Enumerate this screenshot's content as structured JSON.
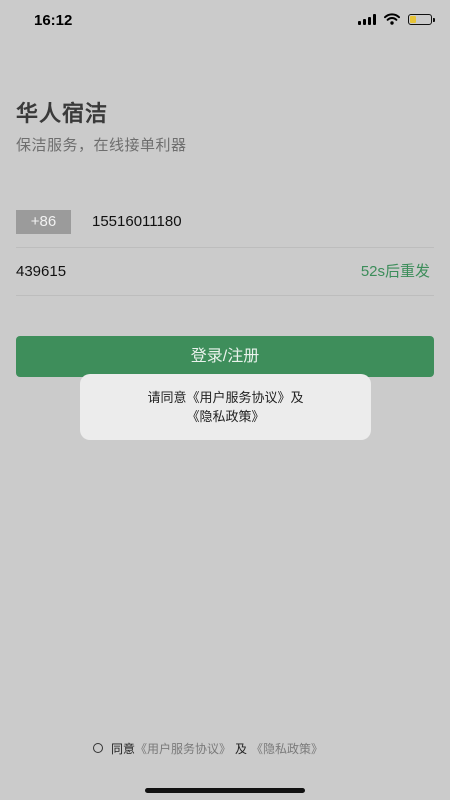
{
  "status_bar": {
    "time": "16:12",
    "battery_level": 0.3,
    "battery_color": "#e7c436"
  },
  "header": {
    "title": "华人宿洁",
    "subtitle": "保洁服务，在线接单利器"
  },
  "phone": {
    "country_code": "+86",
    "number": "15516011180"
  },
  "verification": {
    "code": "439615",
    "resend_label": "52s后重发"
  },
  "login_button": {
    "label": "登录/注册"
  },
  "toast": {
    "line1": "请同意《用户服务协议》及",
    "line2": "《隐私政策》"
  },
  "agreement": {
    "agree_label": "同意",
    "user_agreement": "《用户服务协议》",
    "and": "及",
    "privacy_policy": "《隐私政策》",
    "checked": false
  },
  "colors": {
    "accent": "#3e8e5b",
    "link_green": "#3c8d5a",
    "background": "#cbcbcb"
  }
}
